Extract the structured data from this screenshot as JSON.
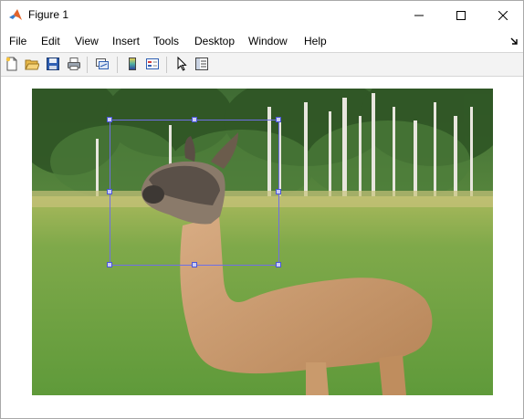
{
  "window": {
    "title": "Figure 1",
    "app_icon": "matlab-logo-icon",
    "controls": [
      "minimize-icon",
      "maximize-icon",
      "close-icon"
    ]
  },
  "menu": {
    "items": [
      "File",
      "Edit",
      "View",
      "Insert",
      "Tools",
      "Desktop",
      "Window",
      "Help"
    ],
    "undock_icon": "undock-arrow-icon"
  },
  "toolbar": {
    "buttons": [
      {
        "icon": "new-figure-icon"
      },
      {
        "icon": "open-file-icon"
      },
      {
        "icon": "save-icon"
      },
      {
        "icon": "print-icon"
      },
      {
        "icon": "link-plot-icon"
      },
      {
        "icon": "colorbar-icon"
      },
      {
        "icon": "legend-icon"
      },
      {
        "icon": "pointer-icon"
      },
      {
        "icon": "property-inspector-icon"
      }
    ]
  },
  "figure": {
    "image": "alpaca-photo",
    "roi_rectangle": {
      "shape": "rectangle",
      "handle_count": 8
    }
  },
  "colors": {
    "roi_line": "#6f6fe6",
    "roi_handle_fill": "#c9cdf5",
    "toolbar_bg": "#f3f3f3"
  }
}
